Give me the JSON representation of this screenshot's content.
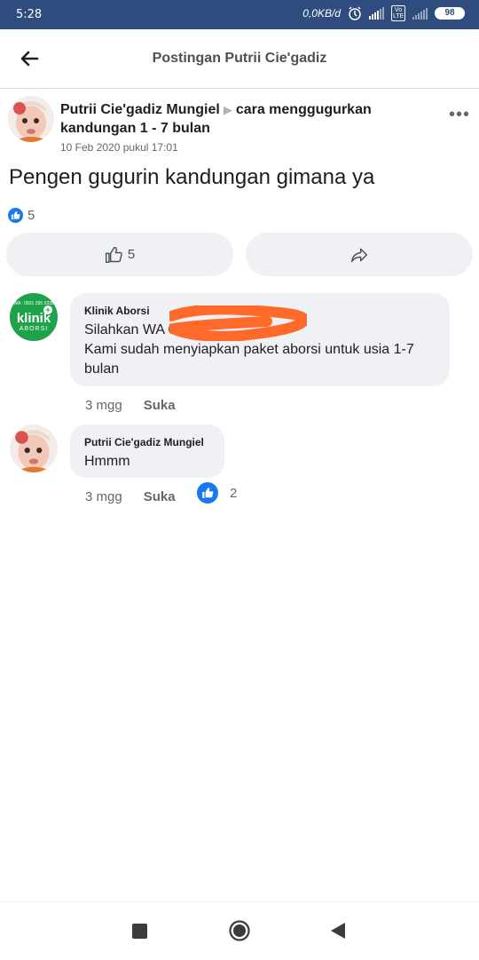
{
  "status_bar": {
    "time": "5:28",
    "network_speed": "0,0KB/d",
    "volte_label": "Vo LTE",
    "battery": "98"
  },
  "header": {
    "title": "Postingan Putrii Cie'gadiz",
    "back_icon": "arrow-left-icon"
  },
  "post": {
    "author": "Putrii Cie'gadiz Mungiel",
    "group_separator": "▶",
    "group": "cara menggugurkan kandungan 1 - 7 bulan",
    "timestamp": "10 Feb 2020 pukul 17:01",
    "more_icon": "more-horizontal-icon",
    "text": "Pengen gugurin kandungan gimana ya",
    "reaction_count": "5",
    "like_button_count": "5",
    "share_icon": "share-arrow-icon"
  },
  "comments": [
    {
      "author": "Klinik Aborsi",
      "avatar_text_tiny": "WA : 0831 295 3335",
      "avatar_text_big": "klinik",
      "avatar_text_small": "ABORSI",
      "text_line1": "Silahkan WA 08",
      "text_line2": "Kami sudah menyiapkan paket aborsi untuk usia 1-7 bulan",
      "time": "3 mgg",
      "like_label": "Suka"
    },
    {
      "author": "Putrii Cie'gadiz Mungiel",
      "text": "Hmmm",
      "time": "3 mgg",
      "like_label": "Suka",
      "reaction_count": "2"
    }
  ],
  "colors": {
    "status_bar": "#2f4c7e",
    "facebook_blue": "#1877f2",
    "bubble": "#eff1f4",
    "redaction": "#ff6a2b",
    "klinik_green": "#1ea24a"
  }
}
